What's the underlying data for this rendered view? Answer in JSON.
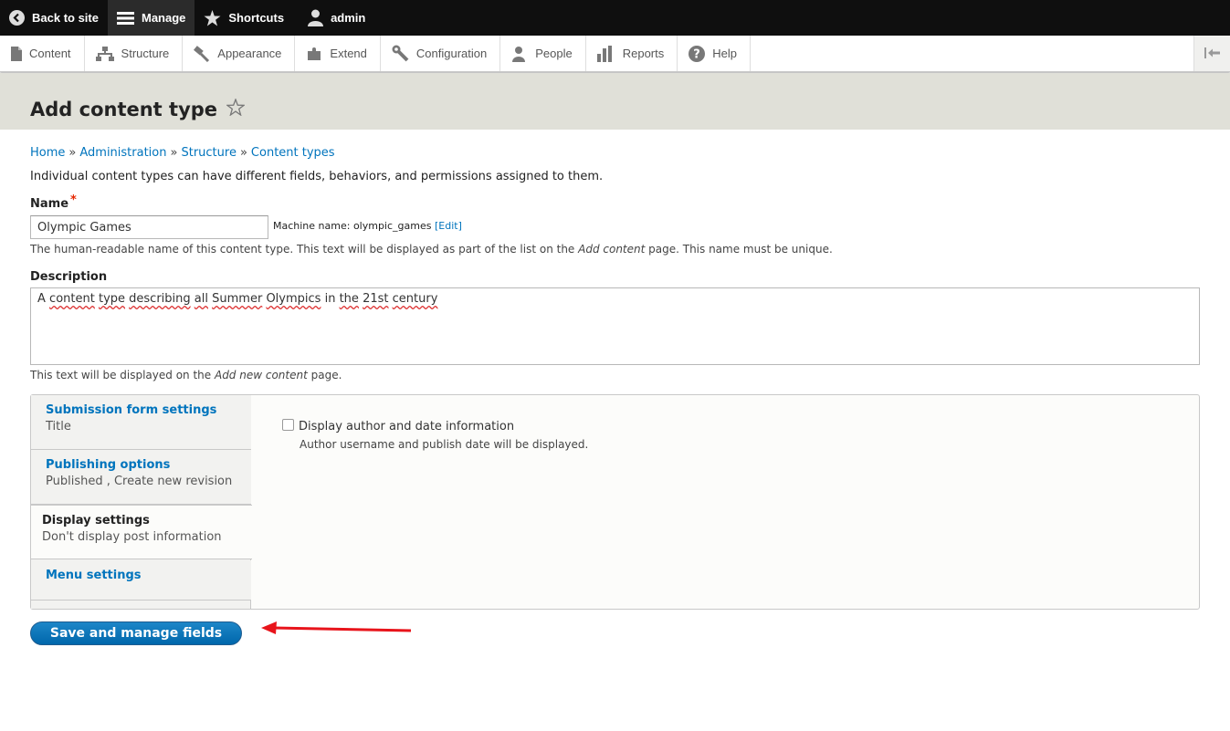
{
  "toolbar": {
    "back_to_site": "Back to site",
    "manage": "Manage",
    "shortcuts": "Shortcuts",
    "user": "admin"
  },
  "tray": {
    "items": [
      "Content",
      "Structure",
      "Appearance",
      "Extend",
      "Configuration",
      "People",
      "Reports",
      "Help"
    ]
  },
  "page": {
    "title": "Add content type"
  },
  "breadcrumb": [
    "Home",
    "Administration",
    "Structure",
    "Content types"
  ],
  "breadcrumb_separator": "»",
  "intro": "Individual content types can have different fields, behaviors, and permissions assigned to them.",
  "form": {
    "name_label": "Name",
    "required_marker": "*",
    "name_value": "Olympic Games",
    "machine_name_prefix": "Machine name: olympic_games",
    "machine_name_edit": "[Edit]",
    "name_help_1": "The human-readable name of this content type. This text will be displayed as part of the list on the ",
    "name_help_em": "Add content",
    "name_help_2": " page. This name must be unique.",
    "description_label": "Description",
    "description_value": "A content type describing all Summer Olympics in the 21st century",
    "description_help_1": "This text will be displayed on the ",
    "description_help_em": "Add new content",
    "description_help_2": " page."
  },
  "vertical_tabs": [
    {
      "title": "Submission form settings",
      "summary": "Title"
    },
    {
      "title": "Publishing options",
      "summary": "Published , Create new revision"
    },
    {
      "title": "Display settings",
      "summary": "Don't display post information",
      "selected": true
    },
    {
      "title": "Menu settings",
      "summary": ""
    }
  ],
  "display_settings": {
    "checkbox_label": "Display author and date information",
    "checkbox_help": "Author username and publish date will be displayed.",
    "checked": false
  },
  "actions": {
    "save": "Save and manage fields"
  },
  "colors": {
    "link": "#0074bd",
    "toolbar_bg": "#0f0f0f",
    "header_bg": "#e0e0d8",
    "button": "#0074bd",
    "annotation_arrow": "#e8141b"
  }
}
